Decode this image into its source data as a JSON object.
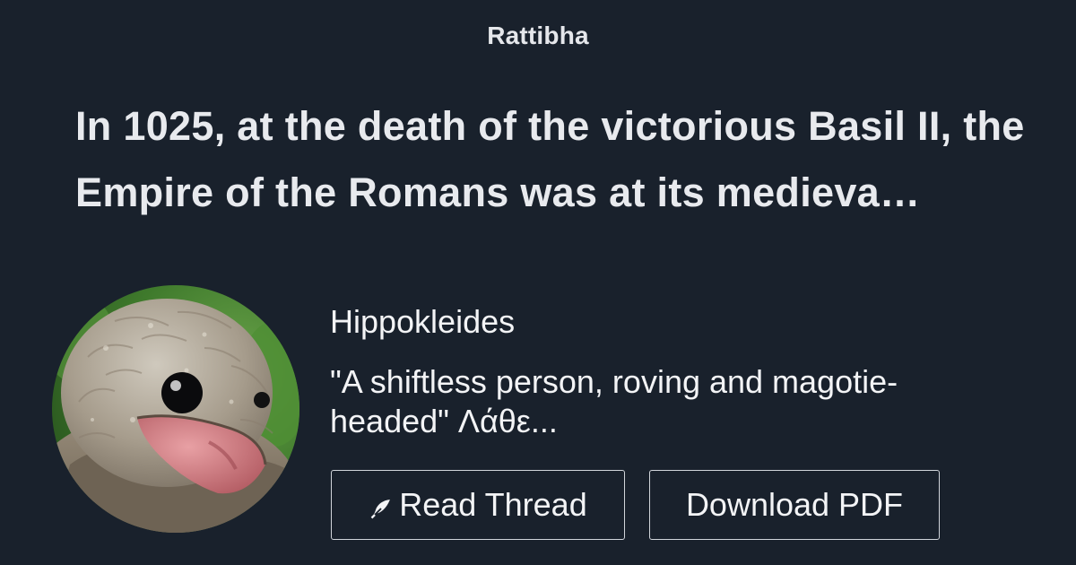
{
  "brand": {
    "name": "Rattibha"
  },
  "thread": {
    "title": "In 1025, at the death of the victorious Basil II, the Empire of the Romans was at its medieva…"
  },
  "author": {
    "name": "Hippokleides",
    "bio": "\"A shiftless person, roving and magotie-headed\" Λάθε...",
    "avatar_icon": "potoo-bird-avatar"
  },
  "actions": {
    "read_label": "Read Thread",
    "read_icon": "feather-icon",
    "download_label": "Download PDF"
  },
  "colors": {
    "background": "#19212c",
    "text": "#f3f4f6",
    "button_border": "#d1d5db"
  }
}
